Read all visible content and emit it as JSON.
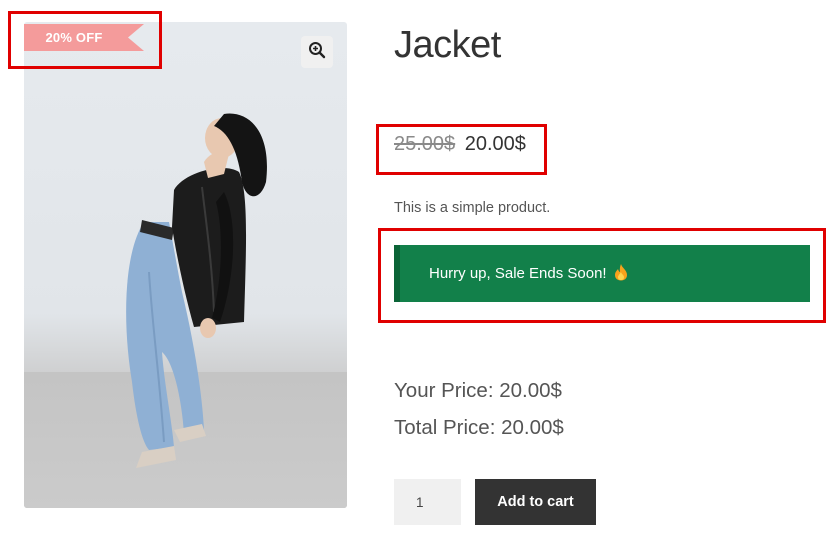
{
  "product": {
    "title": "Jacket",
    "old_price": "25.00$",
    "new_price": "20.00$",
    "short_description": "This is a simple product.",
    "image_icon": "zoom-in-icon"
  },
  "sale_badge": {
    "label": "20% OFF",
    "color": "#f49b9b"
  },
  "sale_notice": {
    "text": "Hurry up, Sale Ends Soon!",
    "icon": "fire-icon",
    "background": "#12804a"
  },
  "price_summary": {
    "your_price": "Your Price: 20.00$",
    "total_price": "Total Price: 20.00$"
  },
  "cart": {
    "quantity": "1",
    "button_label": "Add to cart"
  },
  "annotations": {
    "highlight_color": "#e00000"
  }
}
